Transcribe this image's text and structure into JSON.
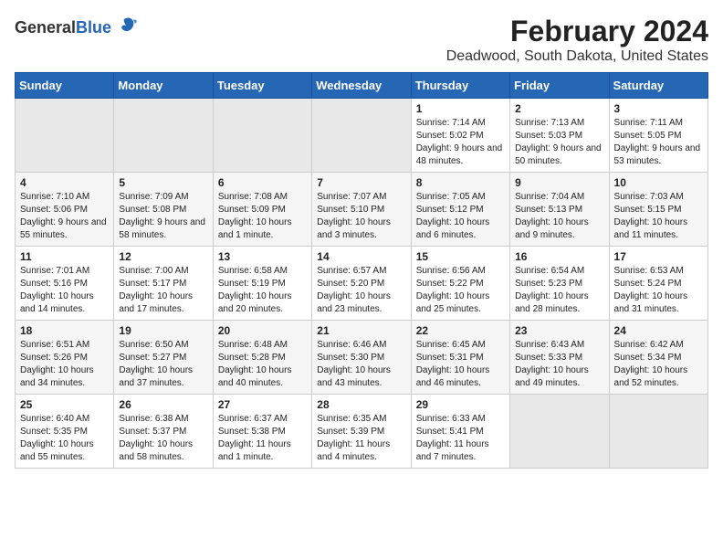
{
  "header": {
    "logo_general": "General",
    "logo_blue": "Blue",
    "title": "February 2024",
    "subtitle": "Deadwood, South Dakota, United States"
  },
  "days_of_week": [
    "Sunday",
    "Monday",
    "Tuesday",
    "Wednesday",
    "Thursday",
    "Friday",
    "Saturday"
  ],
  "weeks": [
    [
      {
        "day": "",
        "info": ""
      },
      {
        "day": "",
        "info": ""
      },
      {
        "day": "",
        "info": ""
      },
      {
        "day": "",
        "info": ""
      },
      {
        "day": "1",
        "info": "Sunrise: 7:14 AM\nSunset: 5:02 PM\nDaylight: 9 hours and 48 minutes."
      },
      {
        "day": "2",
        "info": "Sunrise: 7:13 AM\nSunset: 5:03 PM\nDaylight: 9 hours and 50 minutes."
      },
      {
        "day": "3",
        "info": "Sunrise: 7:11 AM\nSunset: 5:05 PM\nDaylight: 9 hours and 53 minutes."
      }
    ],
    [
      {
        "day": "4",
        "info": "Sunrise: 7:10 AM\nSunset: 5:06 PM\nDaylight: 9 hours and 55 minutes."
      },
      {
        "day": "5",
        "info": "Sunrise: 7:09 AM\nSunset: 5:08 PM\nDaylight: 9 hours and 58 minutes."
      },
      {
        "day": "6",
        "info": "Sunrise: 7:08 AM\nSunset: 5:09 PM\nDaylight: 10 hours and 1 minute."
      },
      {
        "day": "7",
        "info": "Sunrise: 7:07 AM\nSunset: 5:10 PM\nDaylight: 10 hours and 3 minutes."
      },
      {
        "day": "8",
        "info": "Sunrise: 7:05 AM\nSunset: 5:12 PM\nDaylight: 10 hours and 6 minutes."
      },
      {
        "day": "9",
        "info": "Sunrise: 7:04 AM\nSunset: 5:13 PM\nDaylight: 10 hours and 9 minutes."
      },
      {
        "day": "10",
        "info": "Sunrise: 7:03 AM\nSunset: 5:15 PM\nDaylight: 10 hours and 11 minutes."
      }
    ],
    [
      {
        "day": "11",
        "info": "Sunrise: 7:01 AM\nSunset: 5:16 PM\nDaylight: 10 hours and 14 minutes."
      },
      {
        "day": "12",
        "info": "Sunrise: 7:00 AM\nSunset: 5:17 PM\nDaylight: 10 hours and 17 minutes."
      },
      {
        "day": "13",
        "info": "Sunrise: 6:58 AM\nSunset: 5:19 PM\nDaylight: 10 hours and 20 minutes."
      },
      {
        "day": "14",
        "info": "Sunrise: 6:57 AM\nSunset: 5:20 PM\nDaylight: 10 hours and 23 minutes."
      },
      {
        "day": "15",
        "info": "Sunrise: 6:56 AM\nSunset: 5:22 PM\nDaylight: 10 hours and 25 minutes."
      },
      {
        "day": "16",
        "info": "Sunrise: 6:54 AM\nSunset: 5:23 PM\nDaylight: 10 hours and 28 minutes."
      },
      {
        "day": "17",
        "info": "Sunrise: 6:53 AM\nSunset: 5:24 PM\nDaylight: 10 hours and 31 minutes."
      }
    ],
    [
      {
        "day": "18",
        "info": "Sunrise: 6:51 AM\nSunset: 5:26 PM\nDaylight: 10 hours and 34 minutes."
      },
      {
        "day": "19",
        "info": "Sunrise: 6:50 AM\nSunset: 5:27 PM\nDaylight: 10 hours and 37 minutes."
      },
      {
        "day": "20",
        "info": "Sunrise: 6:48 AM\nSunset: 5:28 PM\nDaylight: 10 hours and 40 minutes."
      },
      {
        "day": "21",
        "info": "Sunrise: 6:46 AM\nSunset: 5:30 PM\nDaylight: 10 hours and 43 minutes."
      },
      {
        "day": "22",
        "info": "Sunrise: 6:45 AM\nSunset: 5:31 PM\nDaylight: 10 hours and 46 minutes."
      },
      {
        "day": "23",
        "info": "Sunrise: 6:43 AM\nSunset: 5:33 PM\nDaylight: 10 hours and 49 minutes."
      },
      {
        "day": "24",
        "info": "Sunrise: 6:42 AM\nSunset: 5:34 PM\nDaylight: 10 hours and 52 minutes."
      }
    ],
    [
      {
        "day": "25",
        "info": "Sunrise: 6:40 AM\nSunset: 5:35 PM\nDaylight: 10 hours and 55 minutes."
      },
      {
        "day": "26",
        "info": "Sunrise: 6:38 AM\nSunset: 5:37 PM\nDaylight: 10 hours and 58 minutes."
      },
      {
        "day": "27",
        "info": "Sunrise: 6:37 AM\nSunset: 5:38 PM\nDaylight: 11 hours and 1 minute."
      },
      {
        "day": "28",
        "info": "Sunrise: 6:35 AM\nSunset: 5:39 PM\nDaylight: 11 hours and 4 minutes."
      },
      {
        "day": "29",
        "info": "Sunrise: 6:33 AM\nSunset: 5:41 PM\nDaylight: 11 hours and 7 minutes."
      },
      {
        "day": "",
        "info": ""
      },
      {
        "day": "",
        "info": ""
      }
    ]
  ]
}
